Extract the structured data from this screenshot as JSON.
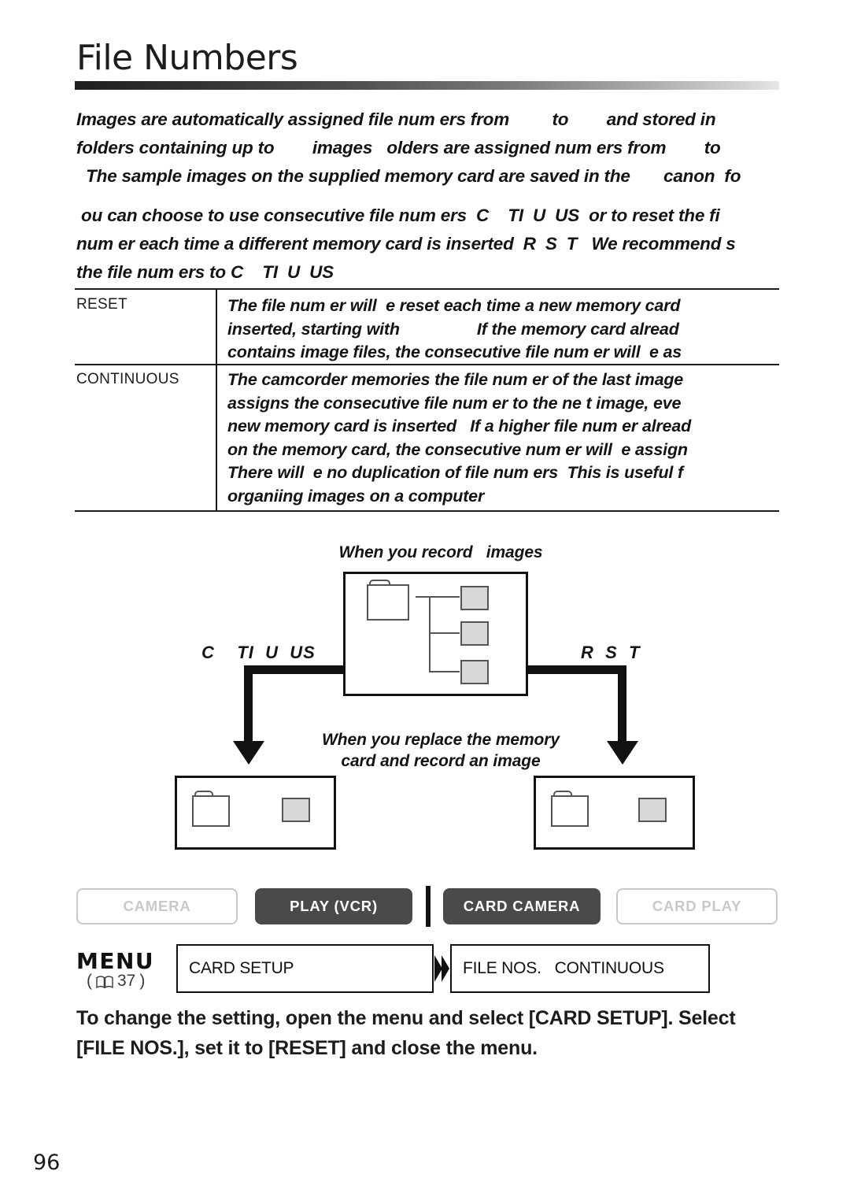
{
  "page": {
    "title": "File Numbers",
    "number": "96"
  },
  "intro": {
    "paragraph_1": "Images are automatically assigned file num ers from         to        and stored in\nfolders containing up to        images   olders are assigned num ers from        to\n  The sample images on the supplied memory card are saved in the       canon  fo",
    "paragraph_2": " ou can choose to use consecutive file num ers  C    TI  U  US  or to reset the fi\nnum er each time a different memory card is inserted  R  S  T   We recommend s\nthe file num ers to C    TI  U  US"
  },
  "options_table": {
    "rows": [
      {
        "label": "RESET",
        "description": "The file num er will  e reset each time a new memory card\ninserted, starting with                 If the memory card alread\ncontains image files, the consecutive file num er will  e as"
      },
      {
        "label": "CONTINUOUS",
        "description": "The camcorder memories the file num er of the last image\nassigns the consecutive file num er to the ne t image, eve\nnew memory card is inserted   If a higher file num er alread\non the memory card, the consecutive num er will  e assign\nThere will  e no duplication of file num ers  This is useful f\norganiing images on a computer"
      }
    ]
  },
  "diagram": {
    "caption_record": "When you record   images",
    "caption_replace": "When you replace the memory\ncard and record an image",
    "label_continuous": "C    TI  U  US",
    "label_reset": "R  S  T"
  },
  "mode_buttons": [
    {
      "label": "CAMERA",
      "state": "off"
    },
    {
      "label": "PLAY (VCR)",
      "state": "on"
    },
    {
      "label": "CARD CAMERA",
      "state": "on"
    },
    {
      "label": "CARD PLAY",
      "state": "off"
    }
  ],
  "menu": {
    "word": "MENU",
    "reference_page": "37",
    "box_1": "CARD SETUP",
    "box_2": "FILE NOS.   CONTINUOUS"
  },
  "footer": {
    "instruction": "To change the setting, open the menu and select [CARD SETUP]. Select\n[FILE NOS.], set it to [RESET] and close the menu."
  },
  "colors": {
    "text": "#1a1a1a",
    "rule_dark": "#1e1e1e",
    "rule_light": "#e8e8e8",
    "button_active_bg": "#4a4a4a",
    "button_inactive_border": "#c9c9c9",
    "thumb_fill": "#d8d8d8"
  }
}
